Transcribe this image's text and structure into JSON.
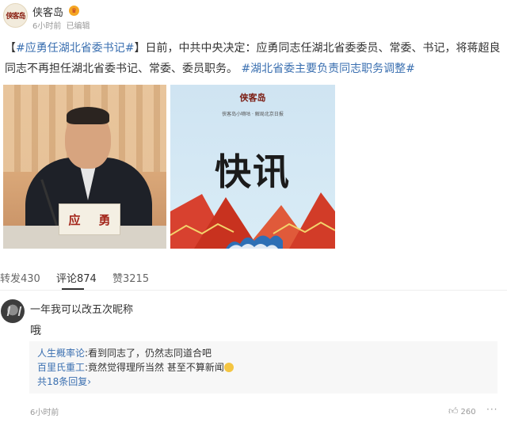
{
  "header": {
    "avatar_text": "侠客岛",
    "author": "侠客岛",
    "vip_icon": "vip-crown-icon",
    "time": "6小时前",
    "edited": "已编辑"
  },
  "post": {
    "open_bracket": "【",
    "topic1": "#应勇任湖北省委书记#",
    "text": "】日前，中共中央决定：应勇同志任湖北省委委员、常委、书记，将蒋超良同志不再担任湖北省委书记、常委、委员职务。",
    "topic2": "#湖北省委主要负责同志职务调整#"
  },
  "images": {
    "photo_nameplate": [
      "应",
      "勇"
    ],
    "card_logo": "侠客岛",
    "card_slogan": "侠客岛小嘀咕 · 解局北京日报",
    "card_title": "快讯"
  },
  "stats": {
    "repost": "转发430",
    "comment": "评论874",
    "like": "赞3215"
  },
  "comment": {
    "name": "一年我可以改五次昵称",
    "text": "哦",
    "replies": [
      {
        "name": "人生概率论",
        "text": ":看到同志了，仍然志同道合吧"
      },
      {
        "name": "百里氏重工",
        "text": ":竟然觉得理所当然 甚至不算新闻"
      }
    ],
    "more_replies": "共18条回复",
    "more_replies_icon": "chevron-right-icon",
    "time": "6小时前",
    "likes": "260",
    "like_icon": "thumbs-up-icon",
    "more_icon": "ellipsis-icon"
  }
}
